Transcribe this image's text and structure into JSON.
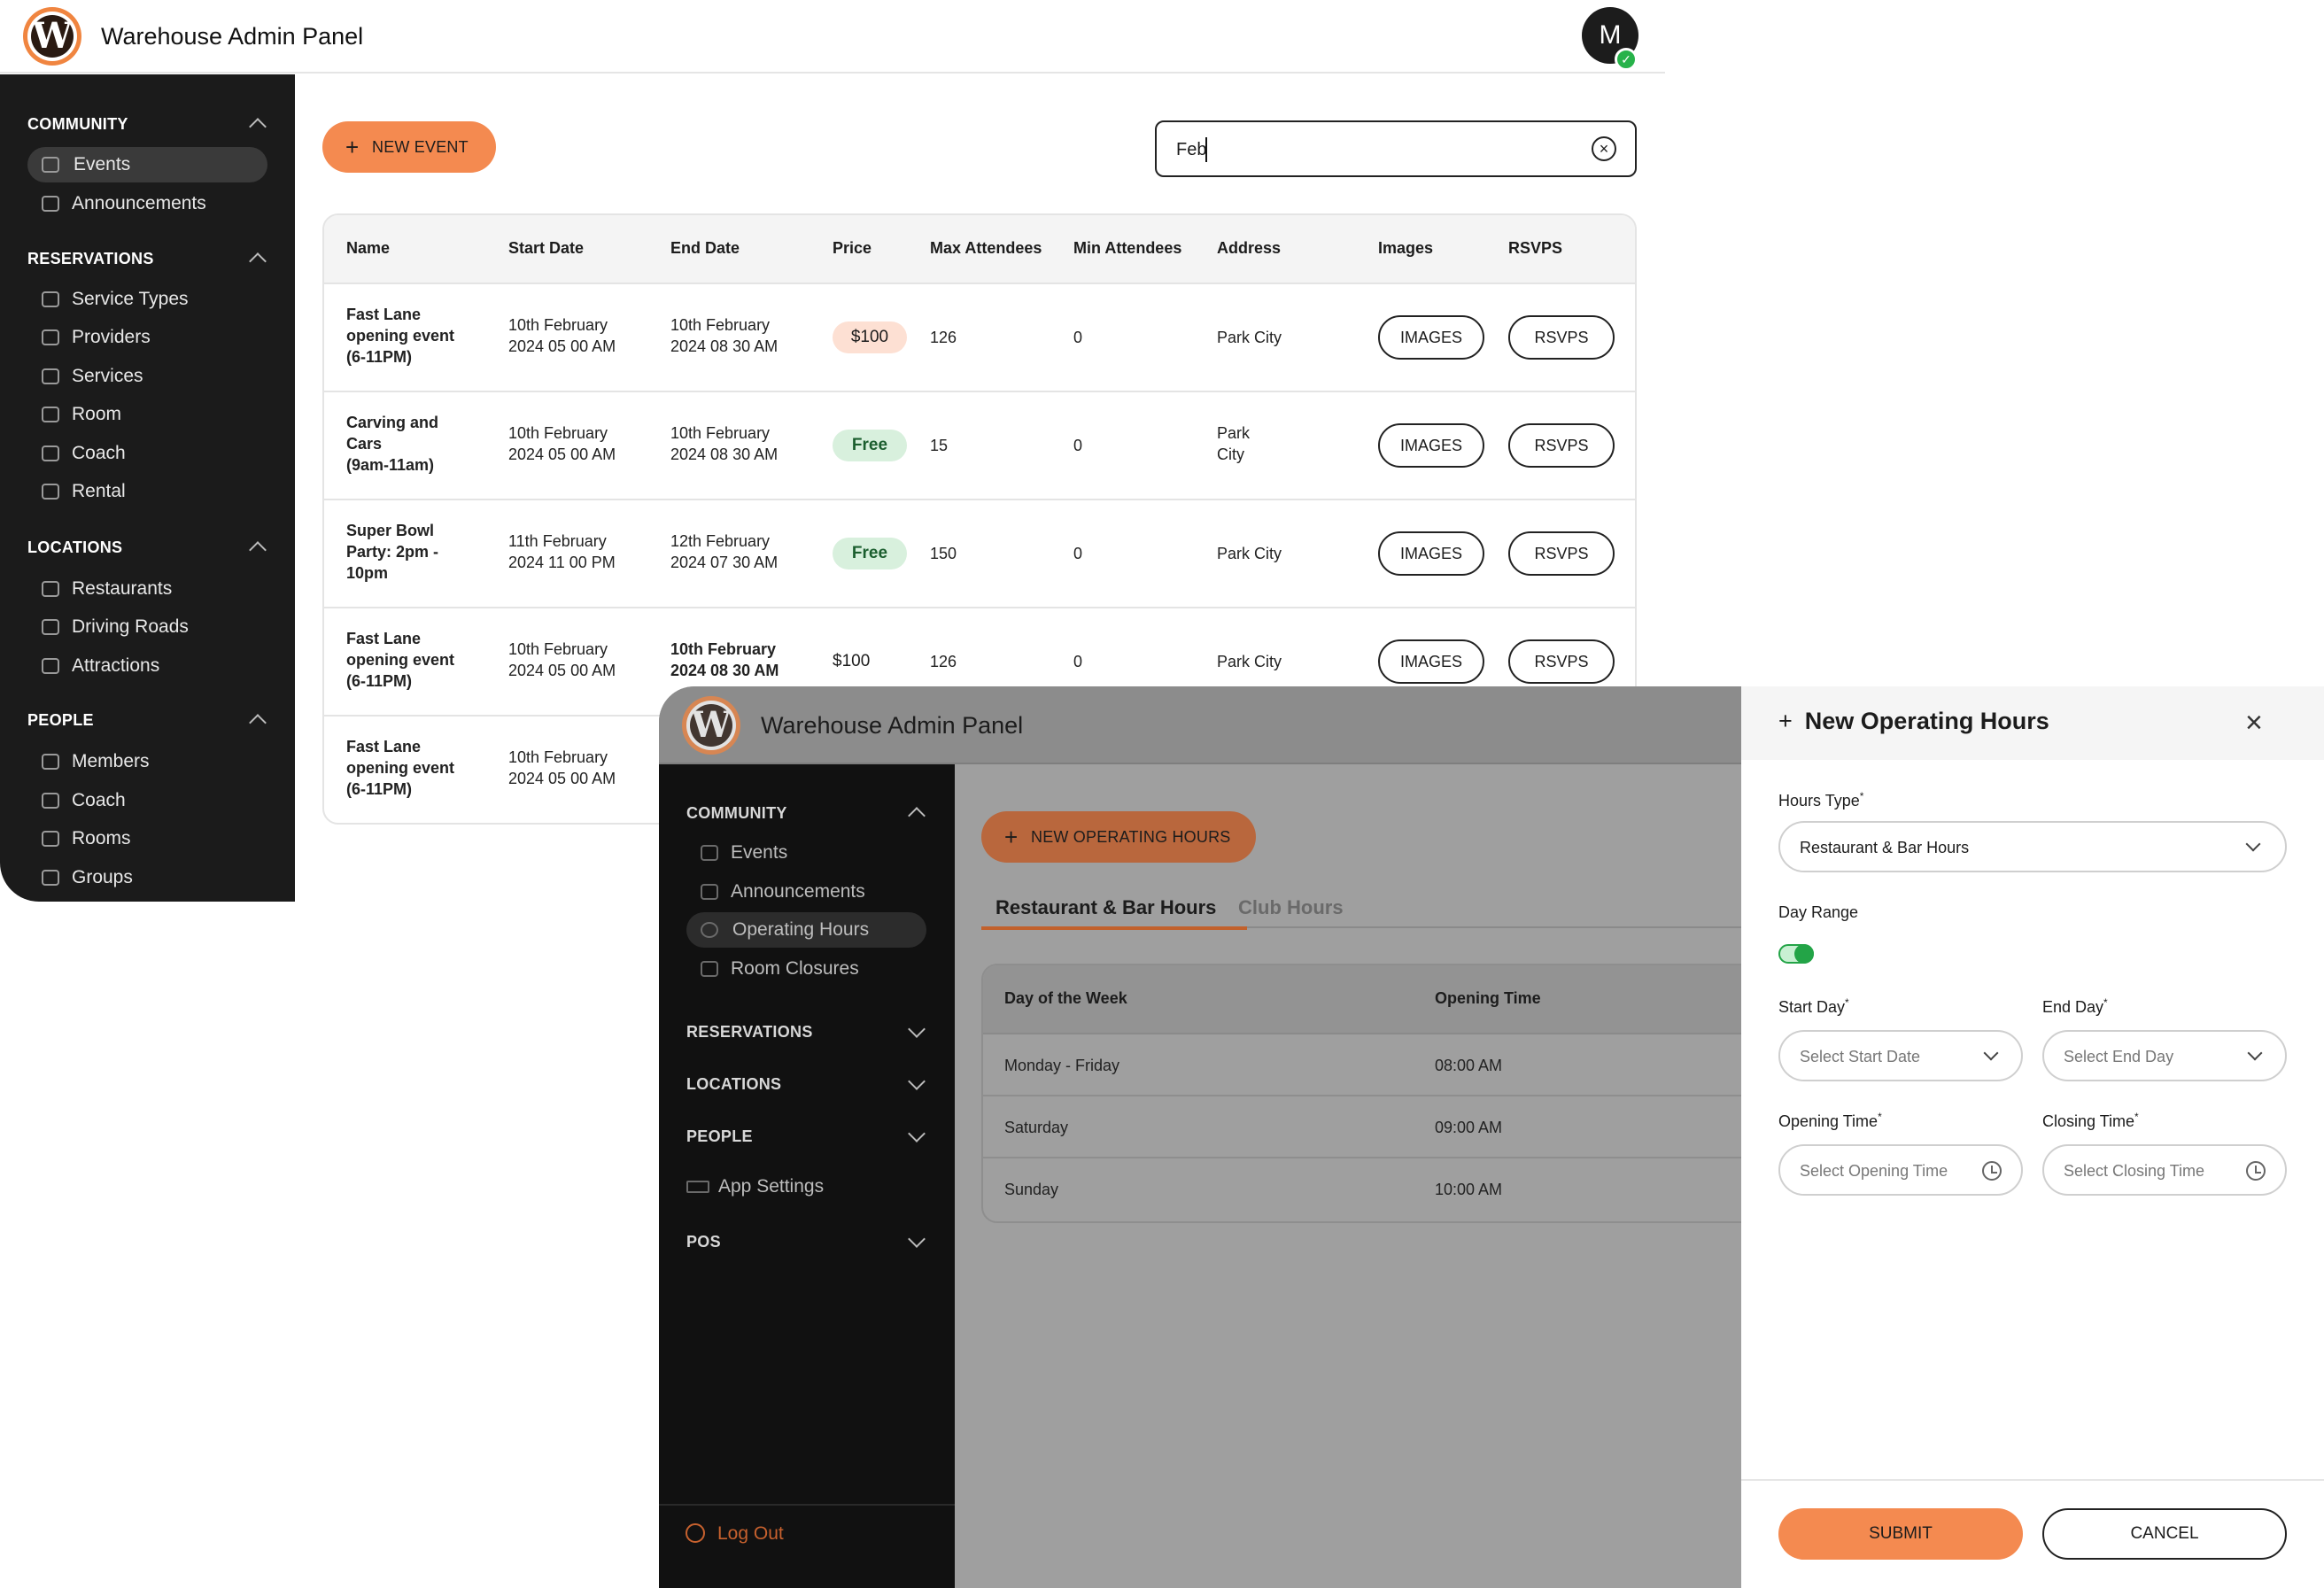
{
  "win1": {
    "app_title": "Warehouse Admin Panel",
    "avatar_initial": "M",
    "nav": {
      "community": {
        "heading": "COMMUNITY",
        "items": [
          "Events",
          "Announcements"
        ]
      },
      "reservations": {
        "heading": "RESERVATIONS",
        "items": [
          "Service Types",
          "Providers",
          "Services",
          "Room",
          "Coach",
          "Rental"
        ]
      },
      "locations": {
        "heading": "LOCATIONS",
        "items": [
          "Restaurants",
          "Driving Roads",
          "Attractions"
        ]
      },
      "people": {
        "heading": "PEOPLE",
        "items": [
          "Members",
          "Coach",
          "Rooms",
          "Groups"
        ]
      }
    },
    "new_event_label": "NEW EVENT",
    "search_value": "Feb",
    "table": {
      "headers": [
        "Name",
        "Start Date",
        "End Date",
        "Price",
        "Max Attendees",
        "Min Attendees",
        "Address",
        "Images",
        "RSVPS"
      ],
      "rows": [
        {
          "name": "Fast Lane\nopening event\n(6-11PM)",
          "start": "10th February\n2024 05 00 AM",
          "end": "10th February\n2024 08 30 AM",
          "price": "$100",
          "max": "126",
          "min": "0",
          "address": "Park City",
          "images": "IMAGES",
          "rsvps": "RSVPS"
        },
        {
          "name": "Carving and\nCars\n(9am-11am)",
          "start": "10th February\n2024 05 00 AM",
          "end": "10th February\n2024 08 30 AM",
          "price": "Free",
          "max": "15",
          "min": "0",
          "address": "Park\nCity",
          "images": "IMAGES",
          "rsvps": "RSVPS"
        },
        {
          "name": "Super Bowl\nParty: 2pm -\n10pm",
          "start": "11th February\n2024 11 00 PM",
          "end": "12th February\n2024 07 30 AM",
          "price": "Free",
          "max": "150",
          "min": "0",
          "address": "Park City",
          "images": "IMAGES",
          "rsvps": "RSVPS"
        },
        {
          "name": "Fast Lane\nopening event\n(6-11PM)",
          "start": "10th February\n2024 05 00 AM",
          "end": "10th February\n2024 08 30 AM",
          "price": "$100",
          "max": "126",
          "min": "0",
          "address": "Park City",
          "images": "IMAGES",
          "rsvps": "RSVPS"
        },
        {
          "name": "Fast Lane\nopening event\n(6-11PM)",
          "start": "10th February\n2024 05 00 AM"
        }
      ]
    }
  },
  "win2": {
    "app_title": "Warehouse Admin Panel",
    "nav": {
      "community": {
        "heading": "COMMUNITY",
        "items": [
          "Events",
          "Announcements",
          "Operating Hours",
          "Room Closures"
        ]
      },
      "reservations": "RESERVATIONS",
      "locations": "LOCATIONS",
      "people": "PEOPLE",
      "app_settings": "App Settings",
      "pos": "POS",
      "logout": "Log Out"
    },
    "new_hours_label": "NEW OPERATING HOURS",
    "tabs": [
      "Restaurant & Bar Hours",
      "Club Hours"
    ],
    "hours_table": {
      "headers": [
        "Day of the Week",
        "Opening Time"
      ],
      "rows": [
        {
          "day": "Monday - Friday",
          "time": "08:00 AM"
        },
        {
          "day": "Saturday",
          "time": "09:00 AM"
        },
        {
          "day": "Sunday",
          "time": "10:00 AM"
        }
      ]
    },
    "drawer": {
      "title": "New Operating Hours",
      "hours_type_label": "Hours Type",
      "hours_type_value": "Restaurant & Bar Hours",
      "day_range_label": "Day Range",
      "start_day_label": "Start Day",
      "start_day_placeholder": "Select Start Date",
      "end_day_label": "End Day",
      "end_day_placeholder": "Select End Day",
      "opening_time_label": "Opening Time",
      "opening_time_placeholder": "Select Opening Time",
      "closing_time_label": "Closing Time",
      "closing_time_placeholder": "Select Closing Time",
      "required_mark": "*",
      "submit_label": "SUBMIT",
      "cancel_label": "CANCEL"
    }
  },
  "colors": {
    "accent": "#f48a50",
    "sidebar": "#1b1b1b",
    "success": "#23a447"
  }
}
